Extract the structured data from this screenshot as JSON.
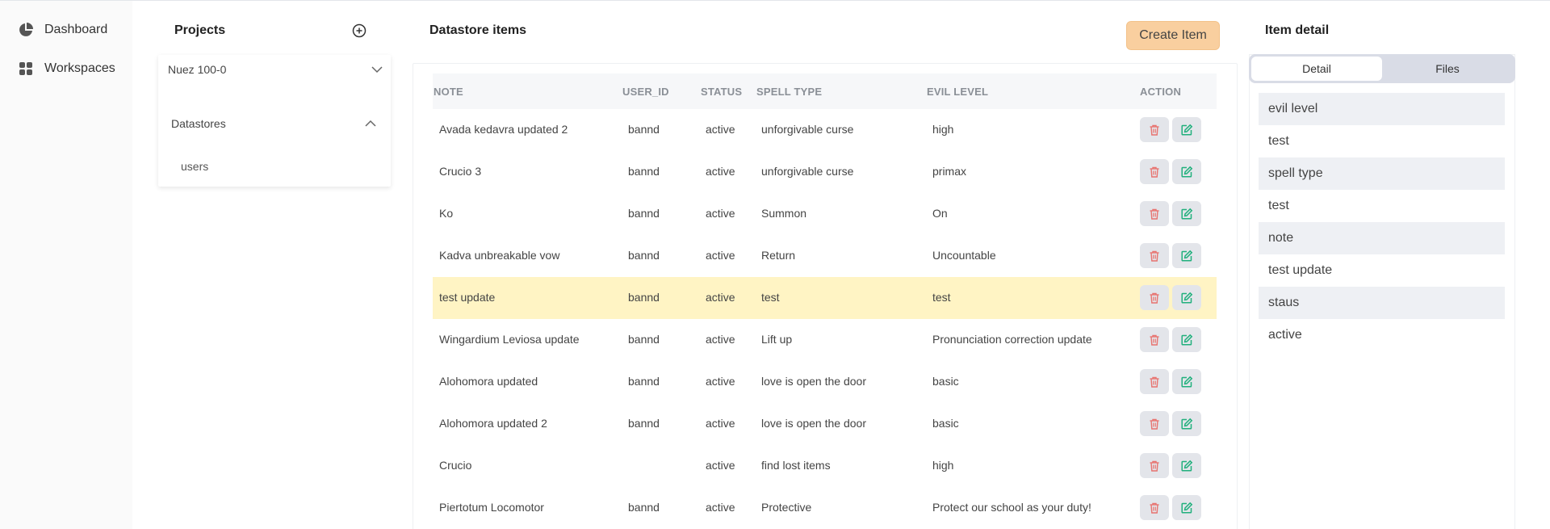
{
  "sidebar": {
    "items": [
      {
        "label": "Dashboard",
        "icon": "pie-chart-icon"
      },
      {
        "label": "Workspaces",
        "icon": "grid-icon"
      }
    ]
  },
  "projects": {
    "title": "Projects",
    "project_name": "Nuez 100-0",
    "datastores_label": "Datastores",
    "datastore_items": [
      "users"
    ]
  },
  "datastore": {
    "title": "Datastore items",
    "create_label": "Create Item",
    "columns": [
      "NOTE",
      "USER_ID",
      "STATUS",
      "SPELL TYPE",
      "EVIL LEVEL",
      "ACTION"
    ],
    "rows": [
      {
        "note": "Avada kedavra updated 2",
        "user_id": "bannd",
        "status": "active",
        "spell_type": "unforgivable curse",
        "evil_level": "high"
      },
      {
        "note": "Crucio 3",
        "user_id": "bannd",
        "status": "active",
        "spell_type": "unforgivable curse",
        "evil_level": "primax"
      },
      {
        "note": "Ko",
        "user_id": "bannd",
        "status": "active",
        "spell_type": "Summon",
        "evil_level": "On"
      },
      {
        "note": "Kadva unbreakable vow",
        "user_id": "bannd",
        "status": "active",
        "spell_type": "Return",
        "evil_level": "Uncountable"
      },
      {
        "note": "test update",
        "user_id": "bannd",
        "status": "active",
        "spell_type": "test",
        "evil_level": "test"
      },
      {
        "note": "Wingardium Leviosa update",
        "user_id": "bannd",
        "status": "active",
        "spell_type": "Lift up",
        "evil_level": "Pronunciation correction update"
      },
      {
        "note": "Alohomora updated",
        "user_id": "bannd",
        "status": "active",
        "spell_type": "love is open the door",
        "evil_level": "basic"
      },
      {
        "note": "Alohomora updated 2",
        "user_id": "bannd",
        "status": "active",
        "spell_type": "love is open the door",
        "evil_level": "basic"
      },
      {
        "note": "Crucio",
        "user_id": "",
        "status": "active",
        "spell_type": "find lost items",
        "evil_level": "high"
      },
      {
        "note": "Piertotum Locomotor",
        "user_id": "bannd",
        "status": "active",
        "spell_type": "Protective",
        "evil_level": "Protect our school as your duty!"
      }
    ],
    "highlight_row": 4
  },
  "detail": {
    "title": "Item detail",
    "tabs": [
      "Detail",
      "Files"
    ],
    "active_tab": "Detail",
    "fields": [
      "evil level",
      "test",
      "spell type",
      "test",
      "note",
      "test update",
      "staus",
      "active"
    ]
  },
  "colors": {
    "accent_button": "#f9cf9f",
    "highlight_row": "#fff4c4",
    "delete_icon": "#e8736f",
    "edit_icon": "#22b07d"
  }
}
